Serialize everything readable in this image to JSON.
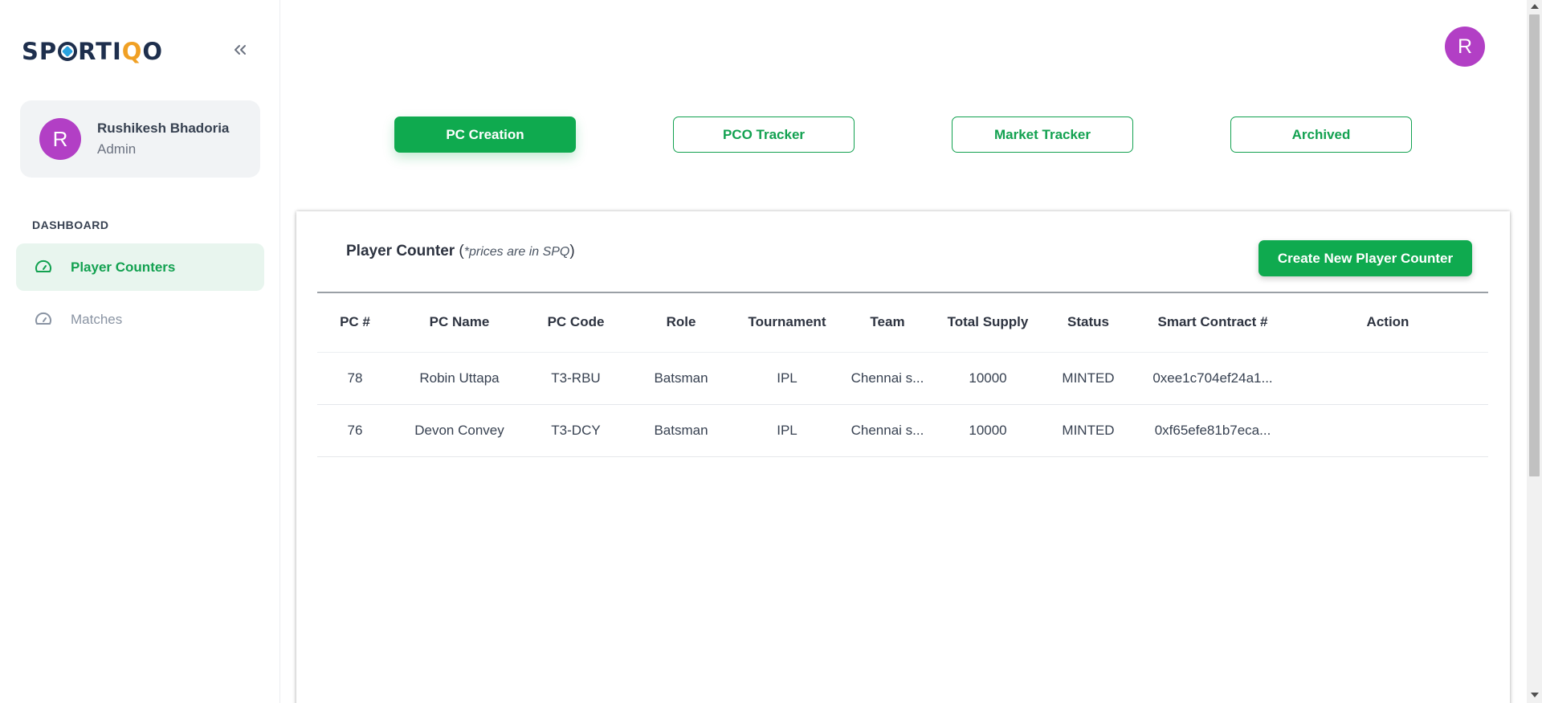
{
  "brand": {
    "logo_pre": "SP",
    "logo_mid": "RTI",
    "logo_accent": "Q",
    "logo_post": "O"
  },
  "user": {
    "initial": "R",
    "name": "Rushikesh Bhadoria",
    "role": "Admin"
  },
  "sidebar": {
    "section": "DASHBOARD",
    "items": [
      {
        "label": "Player Counters",
        "icon": "speedometer-icon",
        "active": true
      },
      {
        "label": "Matches",
        "icon": "speedometer-icon",
        "active": false
      }
    ]
  },
  "tabs": [
    {
      "label": "PC Creation",
      "active": true
    },
    {
      "label": "PCO Tracker",
      "active": false
    },
    {
      "label": "Market Tracker",
      "active": false
    },
    {
      "label": "Archived",
      "active": false
    }
  ],
  "card": {
    "title": "Player Counter",
    "note_open": " (",
    "note": "*prices are in SPQ",
    "note_close": ")",
    "create_button": "Create New Player Counter"
  },
  "table": {
    "headers": [
      "PC #",
      "PC Name",
      "PC Code",
      "Role",
      "Tournament",
      "Team",
      "Total Supply",
      "Status",
      "Smart Contract #",
      "Action"
    ],
    "rows": [
      [
        "78",
        "Robin Uttapa",
        "T3-RBU",
        "Batsman",
        "IPL",
        "Chennai s...",
        "10000",
        "MINTED",
        "0xee1c704ef24a1...",
        ""
      ],
      [
        "76",
        "Devon Convey",
        "T3-DCY",
        "Batsman",
        "IPL",
        "Chennai s...",
        "10000",
        "MINTED",
        "0xf65efe81b7eca...",
        ""
      ]
    ]
  },
  "colors": {
    "accent": "#0faa4f",
    "avatar": "#b23fc5",
    "brand_dark": "#1e2f4d",
    "brand_orange": "#f0a024"
  }
}
